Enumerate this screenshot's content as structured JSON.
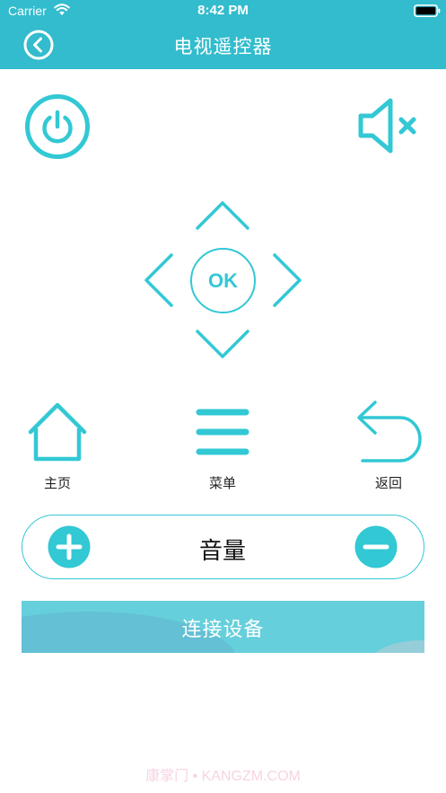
{
  "status_bar": {
    "carrier": "Carrier",
    "time": "8:42 PM",
    "wifi_icon": "wifi-icon",
    "battery_icon": "battery-icon"
  },
  "header": {
    "title": "电视遥控器",
    "back_icon": "chevron-left-circle-icon",
    "background": "#32bccd"
  },
  "controls": {
    "power_icon": "power-icon",
    "mute_icon": "speaker-mute-icon",
    "dpad": {
      "up_icon": "chevron-up-icon",
      "down_icon": "chevron-down-icon",
      "left_icon": "chevron-left-icon",
      "right_icon": "chevron-right-icon",
      "ok_label": "OK"
    },
    "home": {
      "icon": "home-icon",
      "label": "主页"
    },
    "menu": {
      "icon": "menu-icon",
      "label": "菜单"
    },
    "back": {
      "icon": "return-arrow-icon",
      "label": "返回"
    },
    "accent_color": "#32c8d4"
  },
  "volume": {
    "label": "音量",
    "plus_icon": "plus-circle-icon",
    "minus_icon": "minus-circle-icon"
  },
  "connect_button": {
    "label": "连接设备",
    "background": "#66cfdc"
  },
  "watermark": "康掌门 • KANGZM.COM"
}
